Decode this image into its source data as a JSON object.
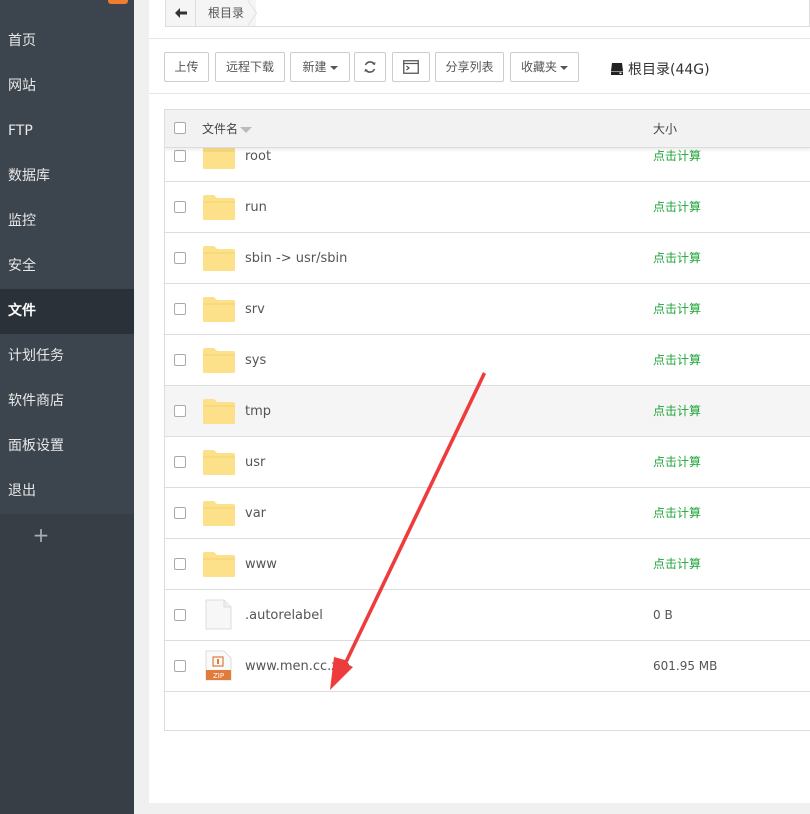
{
  "sidebar": {
    "items": [
      {
        "label": "首页",
        "active": false
      },
      {
        "label": "网站",
        "active": false
      },
      {
        "label": "FTP",
        "active": false
      },
      {
        "label": "数据库",
        "active": false
      },
      {
        "label": "监控",
        "active": false
      },
      {
        "label": "安全",
        "active": false
      },
      {
        "label": "文件",
        "active": true
      },
      {
        "label": "计划任务",
        "active": false
      },
      {
        "label": "软件商店",
        "active": false
      },
      {
        "label": "面板设置",
        "active": false
      },
      {
        "label": "退出",
        "active": false
      }
    ],
    "add_label": "+"
  },
  "breadcrumb": {
    "root": "根目录"
  },
  "toolbar": {
    "upload": "上传",
    "remote_download": "远程下载",
    "new": "新建",
    "share_list": "分享列表",
    "favorites": "收藏夹",
    "disk_label": "根目录(44G)"
  },
  "table": {
    "col_name": "文件名",
    "col_size": "大小",
    "rows": [
      {
        "name": "root",
        "size": "点击计算",
        "type": "folder"
      },
      {
        "name": "run",
        "size": "点击计算",
        "type": "folder"
      },
      {
        "name": "sbin -> usr/sbin",
        "size": "点击计算",
        "type": "folder"
      },
      {
        "name": "srv",
        "size": "点击计算",
        "type": "folder"
      },
      {
        "name": "sys",
        "size": "点击计算",
        "type": "folder"
      },
      {
        "name": "tmp",
        "size": "点击计算",
        "type": "folder",
        "highlight": true
      },
      {
        "name": "usr",
        "size": "点击计算",
        "type": "folder"
      },
      {
        "name": "var",
        "size": "点击计算",
        "type": "folder"
      },
      {
        "name": "www",
        "size": "点击计算",
        "type": "folder"
      },
      {
        "name": ".autorelabel",
        "size": "0 B",
        "type": "file"
      },
      {
        "name": "www.men.cc.zip",
        "size": "601.95 MB",
        "type": "zip"
      }
    ],
    "zip_icon_label": "ZIP"
  },
  "colors": {
    "sidebar_bg": "#3c444d",
    "sidebar_active": "#2b3138",
    "calc_green": "#20a53a",
    "folder_yellow": "#fce18a",
    "arrow_red": "#ee3b3b"
  }
}
